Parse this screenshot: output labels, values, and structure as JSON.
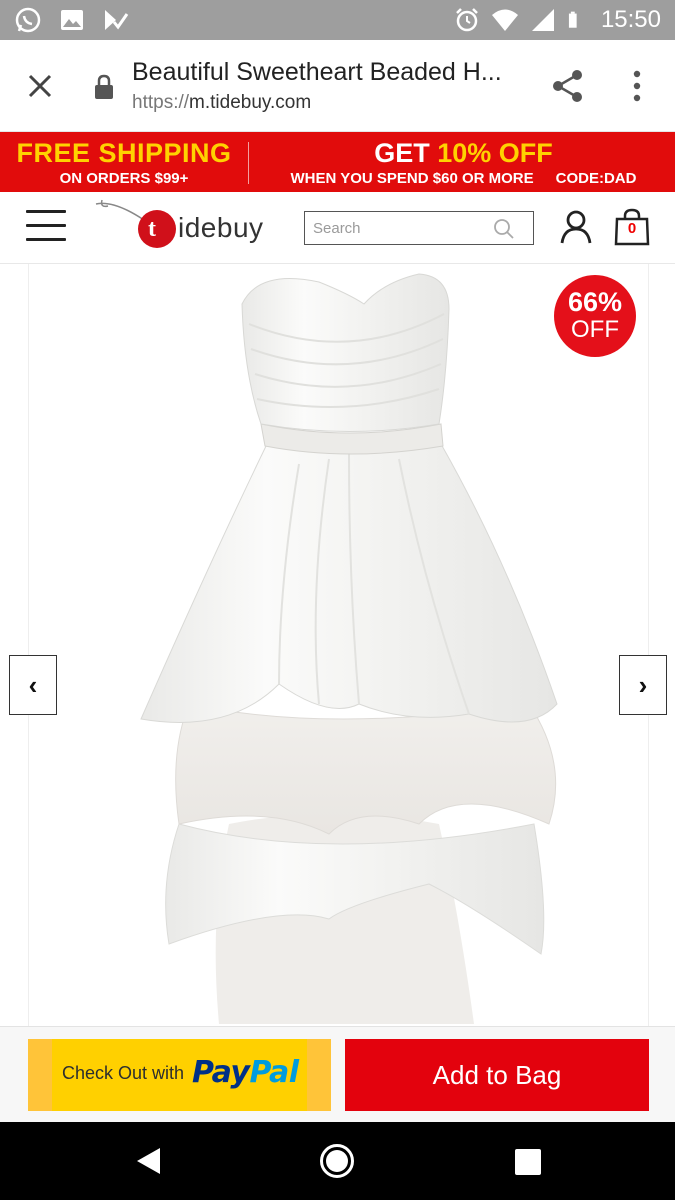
{
  "status_bar": {
    "time": "15:50",
    "left_icons": [
      "whatsapp-icon",
      "image-icon",
      "checklist-icon"
    ],
    "right_icons": [
      "alarm-icon",
      "wifi-icon",
      "signal-icon",
      "battery-icon"
    ]
  },
  "browser": {
    "close_icon": "close-icon",
    "lock_icon": "lock-icon",
    "title": "Beautiful Sweetheart Beaded H...",
    "url_protocol": "https://",
    "url_host": "m.tidebuy.com",
    "share_icon": "share-icon",
    "menu_icon": "more-vertical-icon"
  },
  "promo": {
    "left_big": "FREE SHIPPING",
    "left_small": "ON ORDERS $99+",
    "right_big_prefix": "GET ",
    "right_big_highlight": "10% OFF",
    "right_small": "WHEN YOU SPEND $60 OR MORE",
    "code": "CODE:DAD",
    "colors": {
      "background": "#e10c0c",
      "highlight": "#ffd200"
    }
  },
  "header": {
    "menu_icon": "hamburger-icon",
    "logo_letter": "t",
    "logo_word": "idebuy",
    "search_placeholder": "Search",
    "search_icon": "search-icon",
    "user_icon": "user-icon",
    "bag_icon": "shopping-bag-icon",
    "bag_count": "0"
  },
  "product": {
    "discount_percent": "66%",
    "discount_label": "OFF",
    "prev_label": "‹",
    "next_label": "›",
    "image_description_icon": "white-dress-image"
  },
  "actions": {
    "paypal_prefix": "Check Out with",
    "paypal_brand_1": "Pay",
    "paypal_brand_2": "Pal",
    "add_to_bag": "Add to Bag",
    "colors": {
      "paypal": "#ffd000",
      "add_to_bag": "#e3020d"
    }
  },
  "nav_bar": {
    "back_icon": "back-triangle-icon",
    "home_icon": "home-circle-icon",
    "recent_icon": "recent-apps-icon"
  }
}
